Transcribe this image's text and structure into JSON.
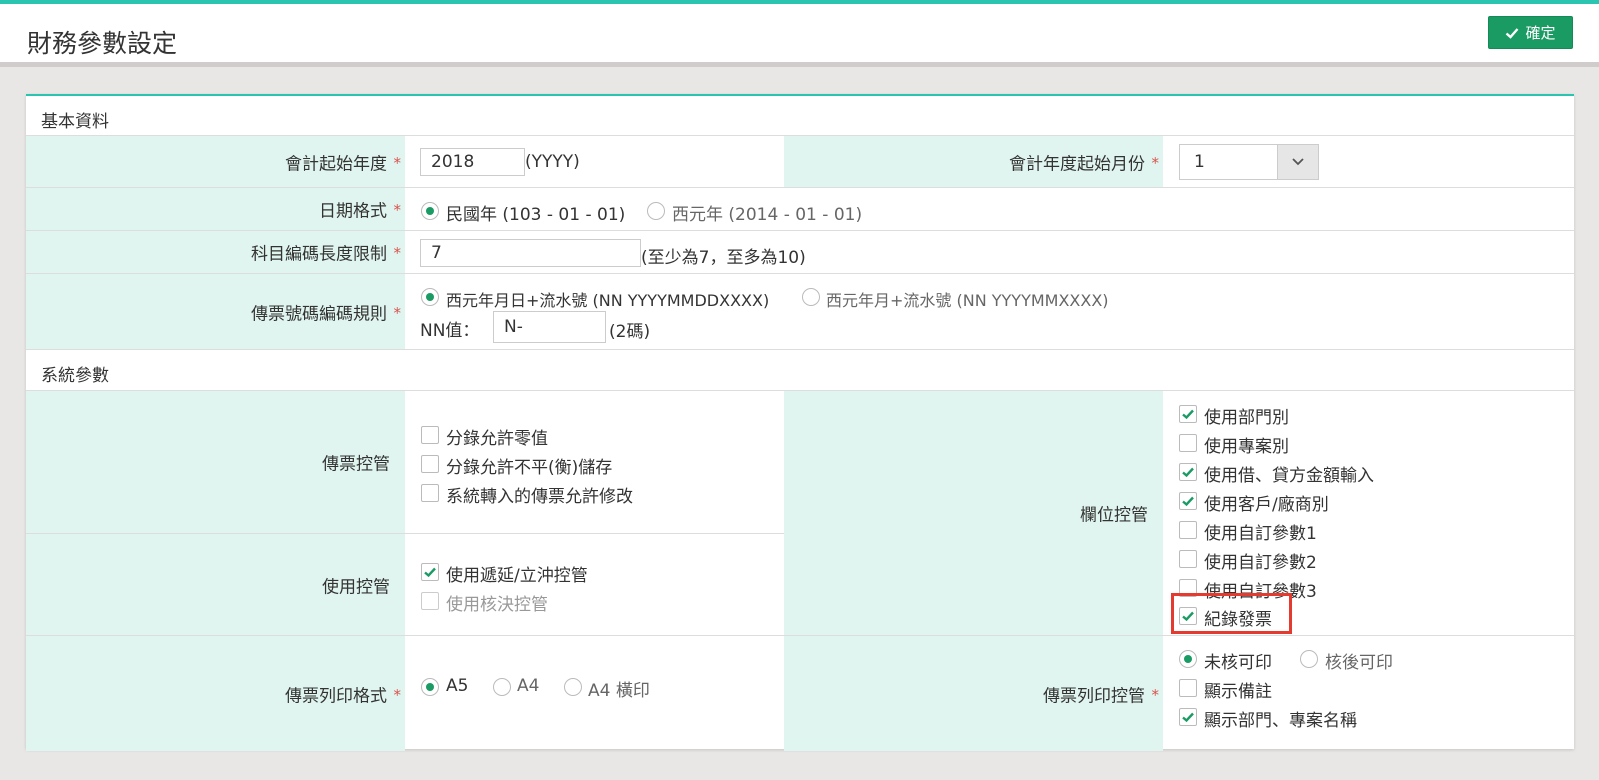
{
  "header": {
    "title": "財務參數設定",
    "confirm_label": "確定",
    "confirm_icon": "check-icon"
  },
  "colors": {
    "accent": "#2bc4b1",
    "confirm_button": "#1a9b63",
    "label_bg": "#e0f5ef",
    "required": "#d9534f",
    "highlight": "#e53a2f"
  },
  "basic": {
    "section_title": "基本資料",
    "start_year": {
      "label": "會計起始年度",
      "value": "2018",
      "suffix": "(YYYY)"
    },
    "start_month": {
      "label": "會計年度起始月份",
      "value": "1"
    },
    "date_format": {
      "label": "日期格式",
      "options": [
        "民國年 (103 - 01 - 01)",
        "西元年 (2014 - 01 - 01)"
      ],
      "selected": 0
    },
    "account_code_len": {
      "label": "科目編碼長度限制",
      "value": "7",
      "suffix": "(至少為7，至多為10)"
    },
    "voucher_rule": {
      "label": "傳票號碼編碼規則",
      "options": [
        "西元年月日+流水號 (NN YYYYMMDDXXXX)",
        "西元年月+流水號 (NN YYYYMMXXXX)"
      ],
      "selected": 0,
      "nn_label": "NN值：",
      "nn_value": "N-",
      "nn_suffix": "(2碼)"
    }
  },
  "system": {
    "section_title": "系統參數",
    "voucher_control": {
      "label": "傳票控管",
      "items": [
        {
          "label": "分錄允許零值",
          "checked": false
        },
        {
          "label": "分錄允許不平(衡)儲存",
          "checked": false
        },
        {
          "label": "系統轉入的傳票允許修改",
          "checked": false
        }
      ]
    },
    "usage_control": {
      "label": "使用控管",
      "items": [
        {
          "label": "使用遞延/立沖控管",
          "checked": true
        },
        {
          "label": "使用核決控管",
          "checked": false,
          "disabled": true
        }
      ]
    },
    "field_control": {
      "label": "欄位控管",
      "items": [
        {
          "label": "使用部門別",
          "checked": true
        },
        {
          "label": "使用專案別",
          "checked": false
        },
        {
          "label": "使用借、貸方金額輸入",
          "checked": true
        },
        {
          "label": "使用客戶/廠商別",
          "checked": true
        },
        {
          "label": "使用自訂參數1",
          "checked": false
        },
        {
          "label": "使用自訂參數2",
          "checked": false
        },
        {
          "label": "使用自訂參數3",
          "checked": false
        },
        {
          "label": "紀錄發票",
          "checked": true
        }
      ]
    },
    "print_format": {
      "label": "傳票列印格式",
      "options": [
        "A5",
        "A4",
        "A4 橫印"
      ],
      "selected": 0
    },
    "print_control": {
      "label": "傳票列印控管",
      "radio_options": [
        "未核可印",
        "核後可印"
      ],
      "radio_selected": 0,
      "items": [
        {
          "label": "顯示備註",
          "checked": false
        },
        {
          "label": "顯示部門、專案名稱",
          "checked": true
        }
      ]
    }
  }
}
